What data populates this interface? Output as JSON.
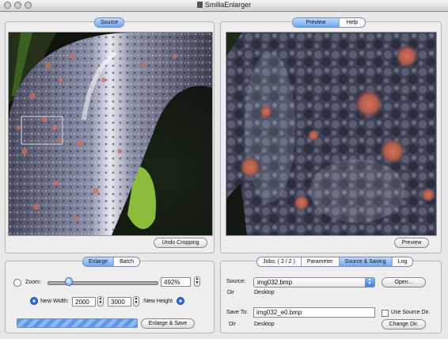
{
  "window": {
    "title": "SmillaEnlarger"
  },
  "left_panel": {
    "tab_label": "Source",
    "undo_crop_label": "Undo Cropping"
  },
  "right_panel": {
    "tabs": [
      "Preview",
      "Help"
    ],
    "active_tab": "Preview",
    "preview_button_label": "Preview"
  },
  "enlarge_panel": {
    "tabs": [
      "Enlarge",
      "Batch"
    ],
    "active_tab": "Enlarge",
    "zoom_label": "Zoom:",
    "zoom_value": "492%",
    "zoom_slider_fraction": 0.17,
    "new_width_label": "New Width:",
    "new_width_value": "2000",
    "new_height_value": "3000",
    "new_height_label": ":New Height",
    "enlarge_save_label": "Enlarge & Save"
  },
  "settings_panel": {
    "tabs": [
      "Jobs: ( 2 / 2 )",
      "Parameter",
      "Source & Saving",
      "Log"
    ],
    "active_tab": "Source & Saving",
    "source_label": "Source:",
    "source_value": "img032.bmp",
    "open_label": "Open...",
    "dir_label": "Dir",
    "source_dir": "Desktop",
    "save_to_label": "Save To:",
    "save_to_value": "img032_e0.bmp",
    "use_source_dir_label": "Use Source Dir.",
    "save_dir_label": "Dir",
    "save_dir": "Desktop",
    "change_dir_label": "Change Dir."
  }
}
